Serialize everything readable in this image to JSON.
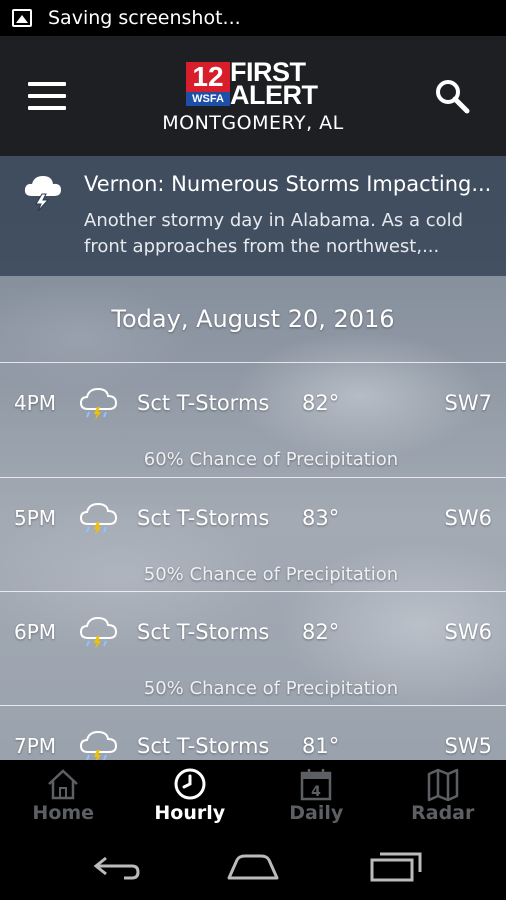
{
  "status_bar": {
    "text": "Saving screenshot..."
  },
  "header": {
    "logo": {
      "number": "12",
      "call_sign": "WSFA",
      "line1": "FIRST",
      "line2": "ALERT"
    },
    "location": "MONTGOMERY, AL"
  },
  "alert": {
    "icon": "thunderstorm-icon",
    "title": "Vernon: Numerous Storms Impacting...",
    "body": "Another stormy day in Alabama. As a cold front approaches from the northwest,..."
  },
  "date_label": "Today, August 20, 2016",
  "hours": [
    {
      "time": "4PM",
      "icon": "scattered-thunderstorms-icon",
      "condition": "Sct T-Storms",
      "temp": "82°",
      "wind": "SW7",
      "precip": "60% Chance of Precipitation"
    },
    {
      "time": "5PM",
      "icon": "scattered-thunderstorms-icon",
      "condition": "Sct T-Storms",
      "temp": "83°",
      "wind": "SW6",
      "precip": "50% Chance of Precipitation"
    },
    {
      "time": "6PM",
      "icon": "scattered-thunderstorms-icon",
      "condition": "Sct T-Storms",
      "temp": "82°",
      "wind": "SW6",
      "precip": "50% Chance of Precipitation"
    },
    {
      "time": "7PM",
      "icon": "scattered-thunderstorms-icon",
      "condition": "Sct T-Storms",
      "temp": "81°",
      "wind": "SW5",
      "precip": ""
    }
  ],
  "tabs": [
    {
      "label": "Home",
      "icon": "home-icon",
      "active": false
    },
    {
      "label": "Hourly",
      "icon": "clock-icon",
      "active": true
    },
    {
      "label": "Daily",
      "icon": "calendar-icon",
      "day": "4",
      "active": false
    },
    {
      "label": "Radar",
      "icon": "map-icon",
      "active": false
    }
  ],
  "nav_bar": {
    "buttons": [
      "back-icon",
      "home-nav-icon",
      "recents-icon"
    ]
  },
  "colors": {
    "logo_red": "#d81e2a",
    "logo_blue": "#1d4fa8",
    "header_bg": "#1e1f22",
    "inactive_tab": "#5c5f63"
  }
}
